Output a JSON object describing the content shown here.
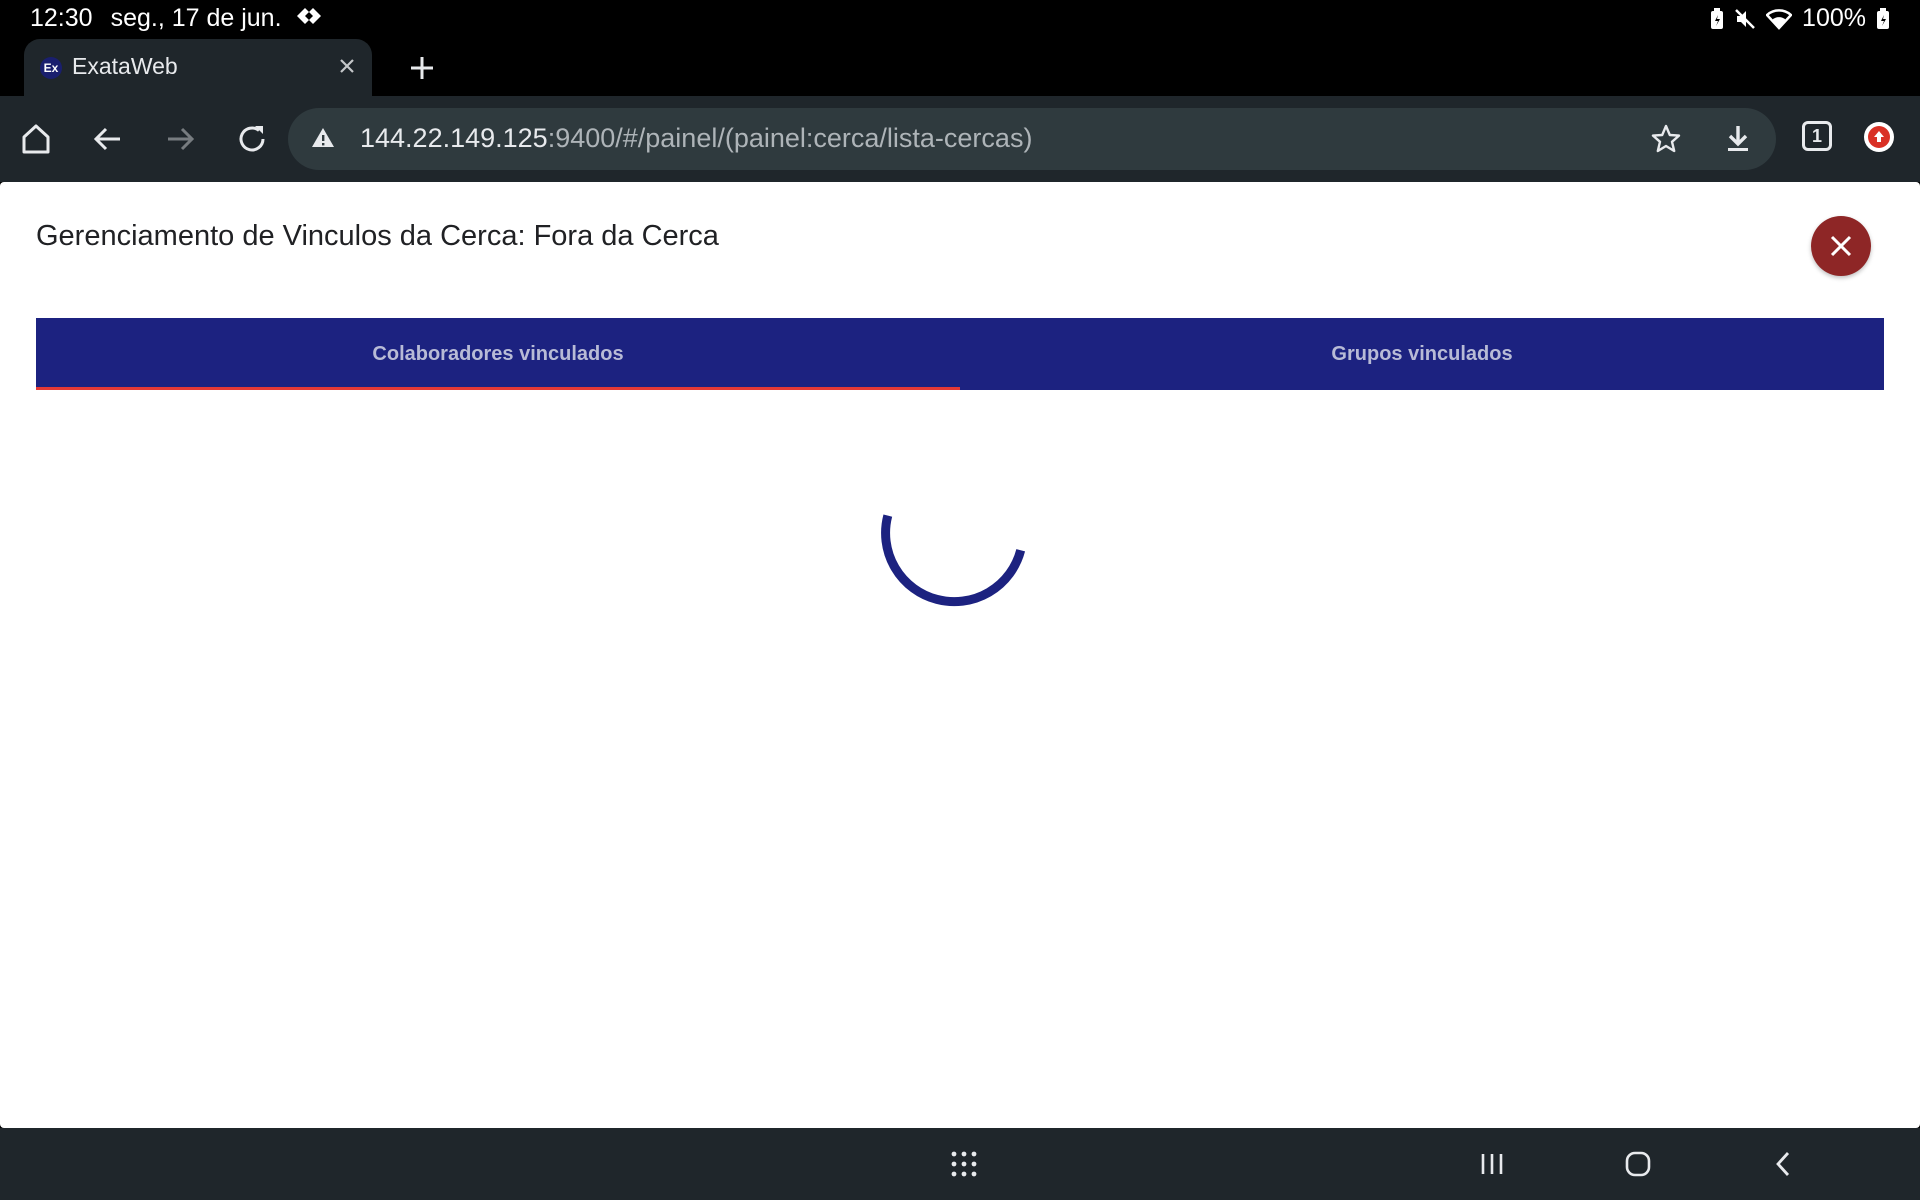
{
  "status_bar": {
    "time": "12:30",
    "date": "seg., 17 de jun.",
    "battery": "100%",
    "icons": [
      "data-saver-icon",
      "battery-saver-icon",
      "mute-icon",
      "wifi-icon",
      "battery-icon"
    ]
  },
  "browser": {
    "tab": {
      "favicon_text": "Ex",
      "title": "ExataWeb"
    },
    "url_host": "144.22.149.125",
    "url_path": ":9400/#/painel/(painel:cerca/lista-cercas)",
    "tabs_count": "1"
  },
  "dialog": {
    "title": "Gerenciamento de Vinculos da Cerca: Fora da Cerca",
    "tabs": [
      {
        "label": "Colaboradores vinculados",
        "active": true
      },
      {
        "label": "Grupos vinculados",
        "active": false
      }
    ],
    "loading": true
  },
  "colors": {
    "tab_bar": "#1c2280",
    "active_indicator": "#e53935",
    "close_button": "#8e2626",
    "spinner": "#1c2280"
  }
}
